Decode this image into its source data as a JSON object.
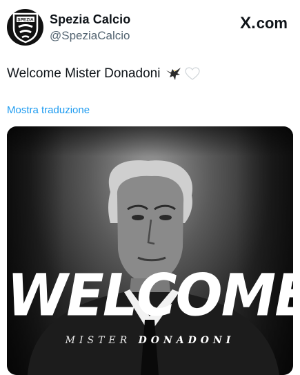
{
  "header": {
    "display_name": "Spezia Calcio",
    "handle": "@SpeziaCalcio",
    "avatar_text": "SPEZIA",
    "brand": "com",
    "brand_prefix": "X."
  },
  "tweet": {
    "text": "Welcome Mister Donadoni",
    "emojis": [
      "eagle-icon",
      "white-heart-icon"
    ],
    "translate_link": "Mostra traduzione"
  },
  "media": {
    "headline": "WELCOME",
    "subline_prefix": "MISTER",
    "subline_name": "DONADONI"
  },
  "colors": {
    "link": "#1d9bf0",
    "secondary_text": "#536471",
    "primary_text": "#0f1419"
  }
}
